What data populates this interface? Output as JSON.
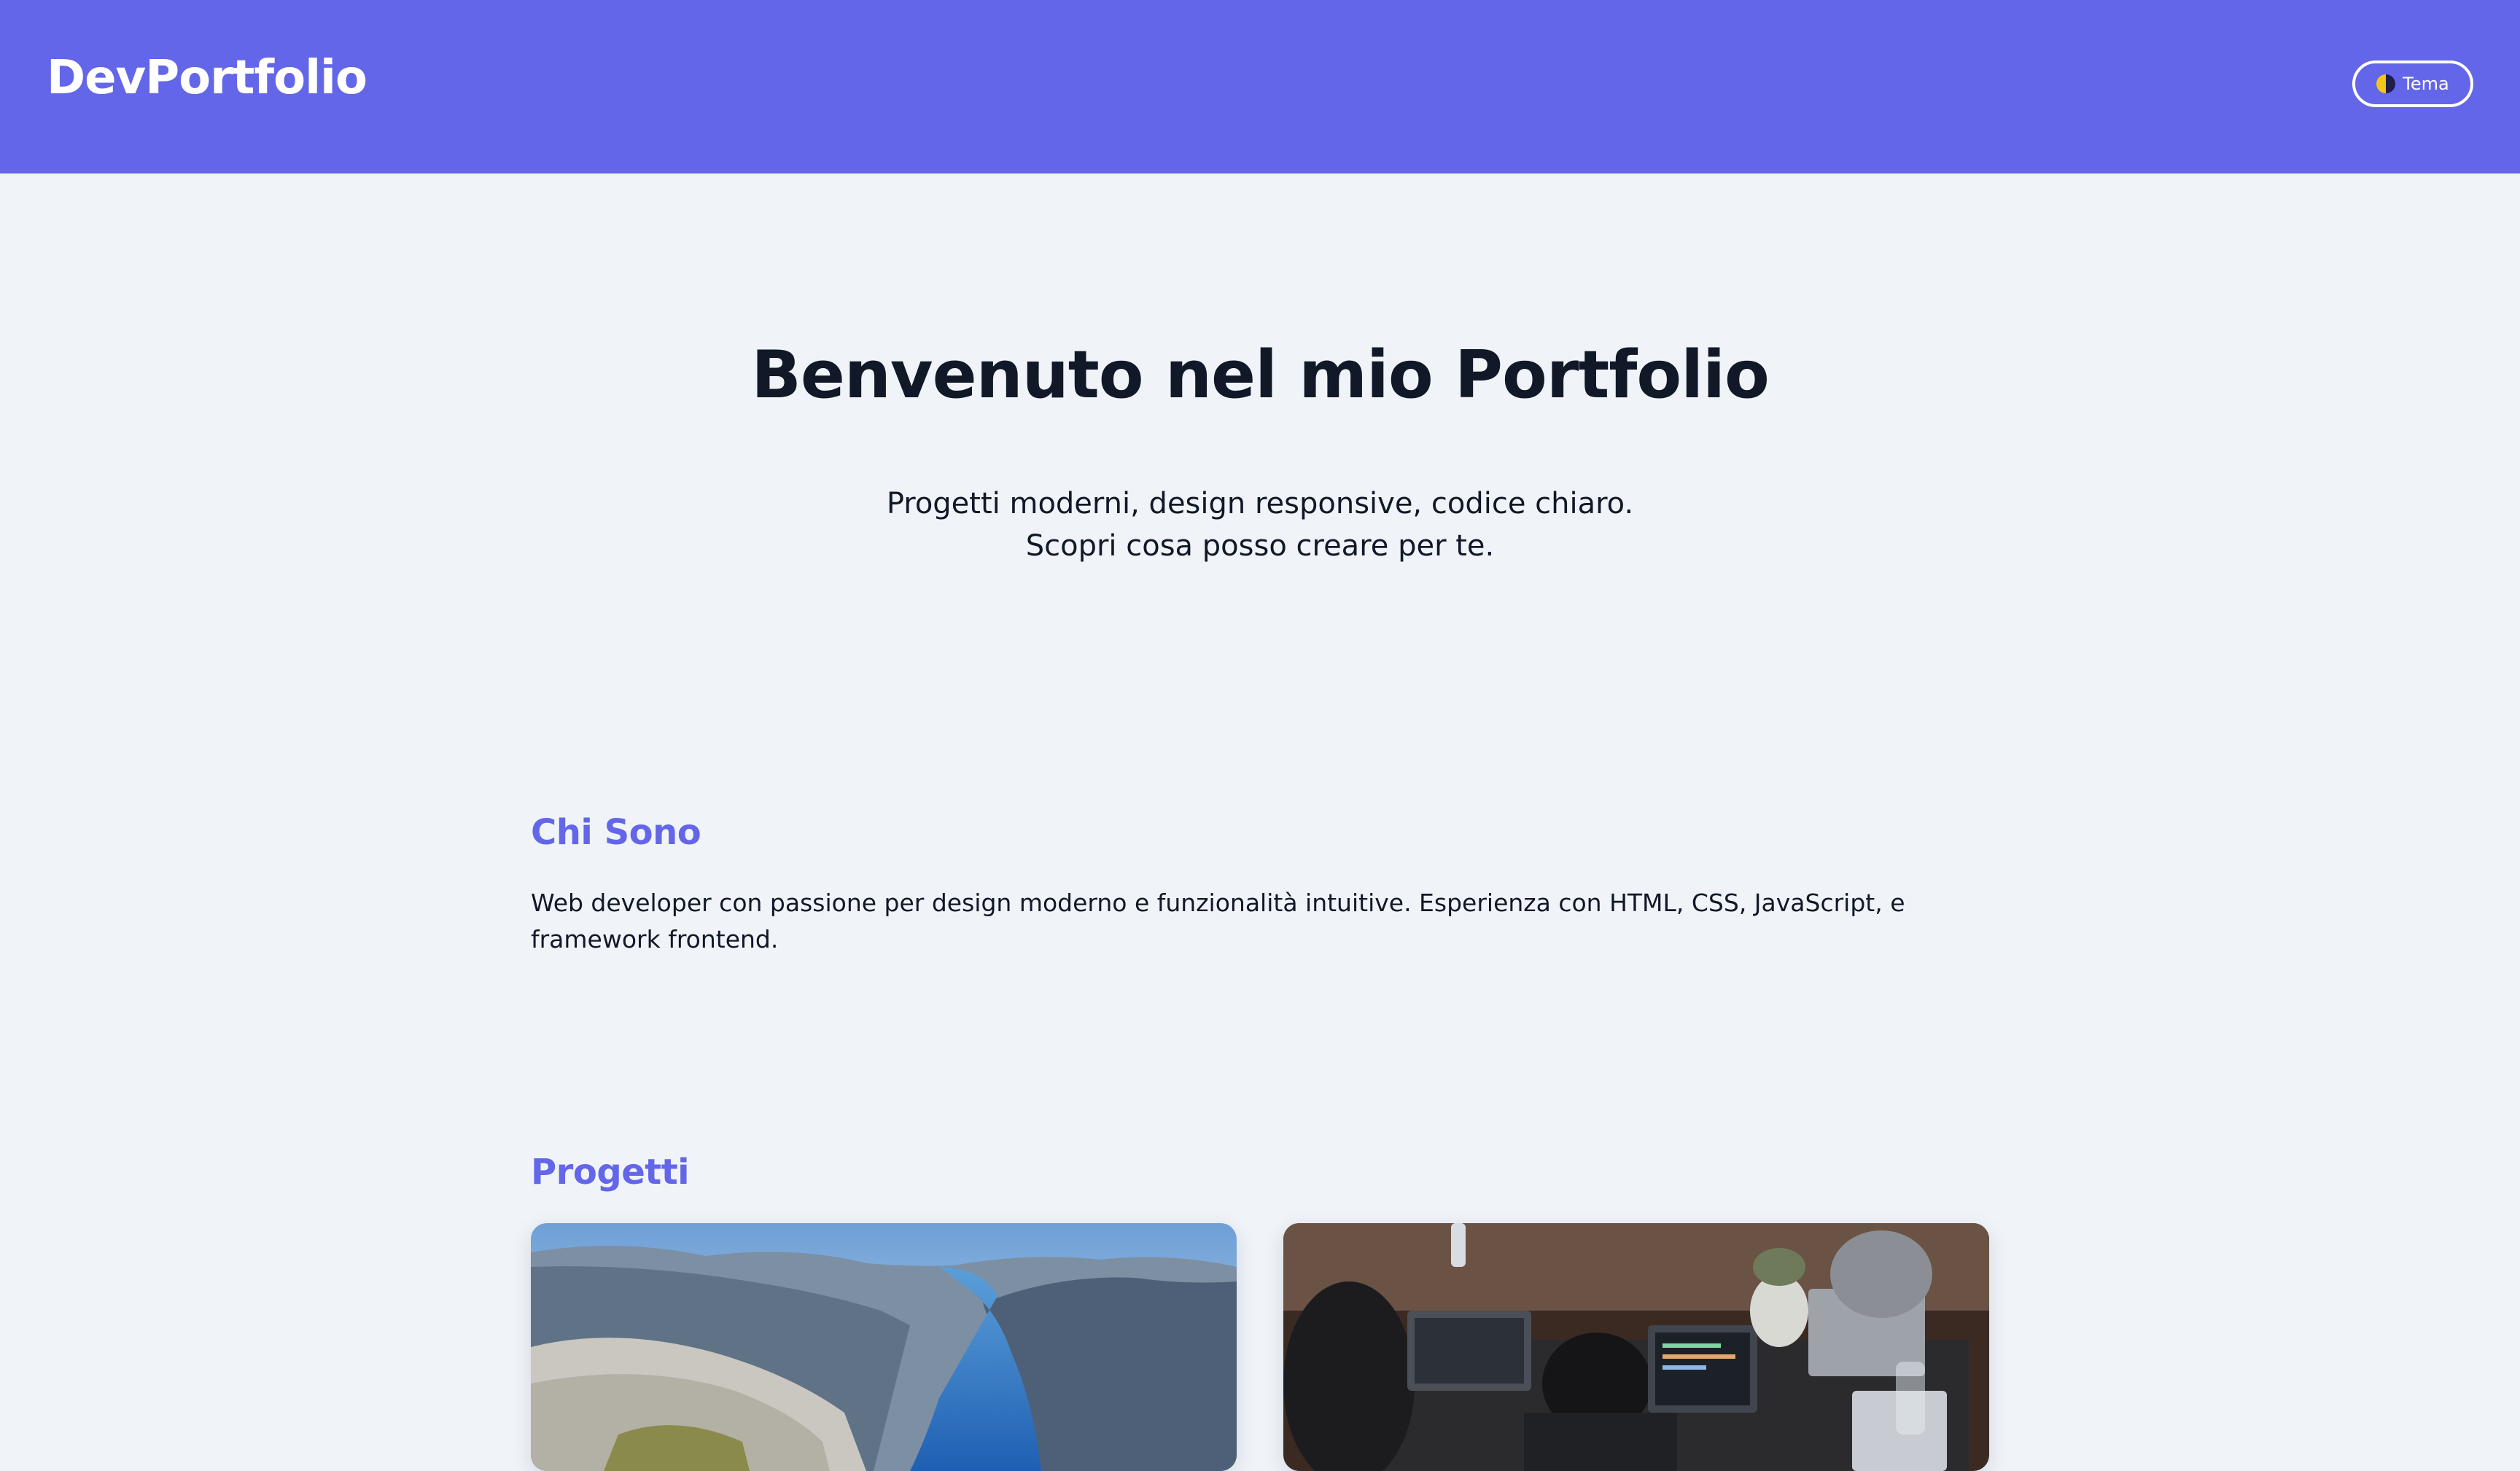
{
  "header": {
    "logo": "DevPortfolio",
    "theme_button_label": "Tema",
    "theme_icon": "half-moon-icon",
    "accent_color": "#6366e9"
  },
  "hero": {
    "title": "Benvenuto nel mio Portfolio",
    "subtitle": "Progetti moderni, design responsive, codice chiaro. Scopri cosa posso creare per te."
  },
  "about": {
    "title": "Chi Sono",
    "text": "Web developer con passione per design moderno e funzionalità intuitive. Esperienza con HTML, CSS, JavaScript, e framework frontend."
  },
  "projects": {
    "title": "Progetti",
    "cards": [
      {
        "image": "fjord-landscape-photo"
      },
      {
        "image": "developers-working-on-laptops-photo"
      }
    ]
  }
}
